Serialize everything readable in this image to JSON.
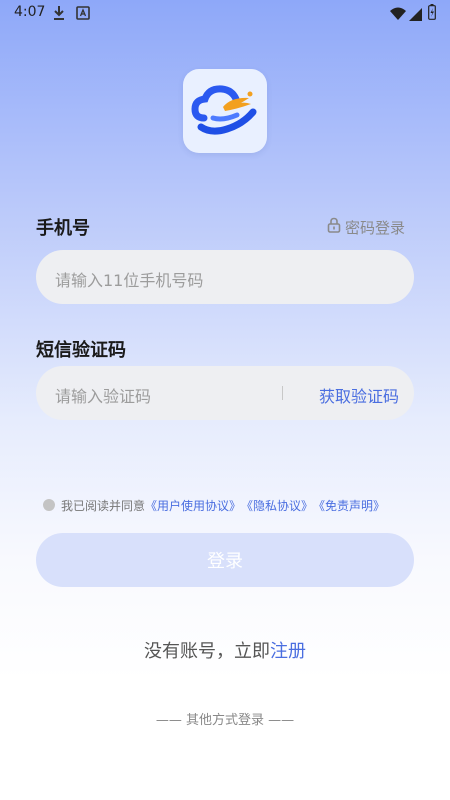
{
  "status_bar": {
    "time": "4:07",
    "left_icons": [
      "download-icon",
      "a-badge-icon"
    ],
    "right_icons": [
      "wifi-icon",
      "signal-icon",
      "battery-icon"
    ]
  },
  "logo": {
    "icon": "cloud-logo-icon",
    "colors": {
      "primary": "#2b59f0",
      "accent": "#f2a020"
    }
  },
  "phone_section": {
    "label": "手机号",
    "password_login_label": "密码登录",
    "input_placeholder": "请输入11位手机号码"
  },
  "code_section": {
    "label": "短信验证码",
    "input_placeholder": "请输入验证码",
    "get_code_label": "获取验证码"
  },
  "agreement": {
    "prefix": "我已阅读并同意",
    "user_agreement": "《用户使用协议》",
    "privacy_agreement": "《隐私协议》",
    "disclaimer": "《免责声明》"
  },
  "login_button": {
    "label": "登录"
  },
  "register": {
    "prefix": "没有账号，立即",
    "link": "注册"
  },
  "other_login": {
    "label": "—— 其他方式登录 ——"
  },
  "colors": {
    "accent": "#4a6ee0",
    "button_disabled": "#d8e0fb",
    "field_background": "#eeeff2",
    "gradient_top": "#8ea8f9"
  }
}
